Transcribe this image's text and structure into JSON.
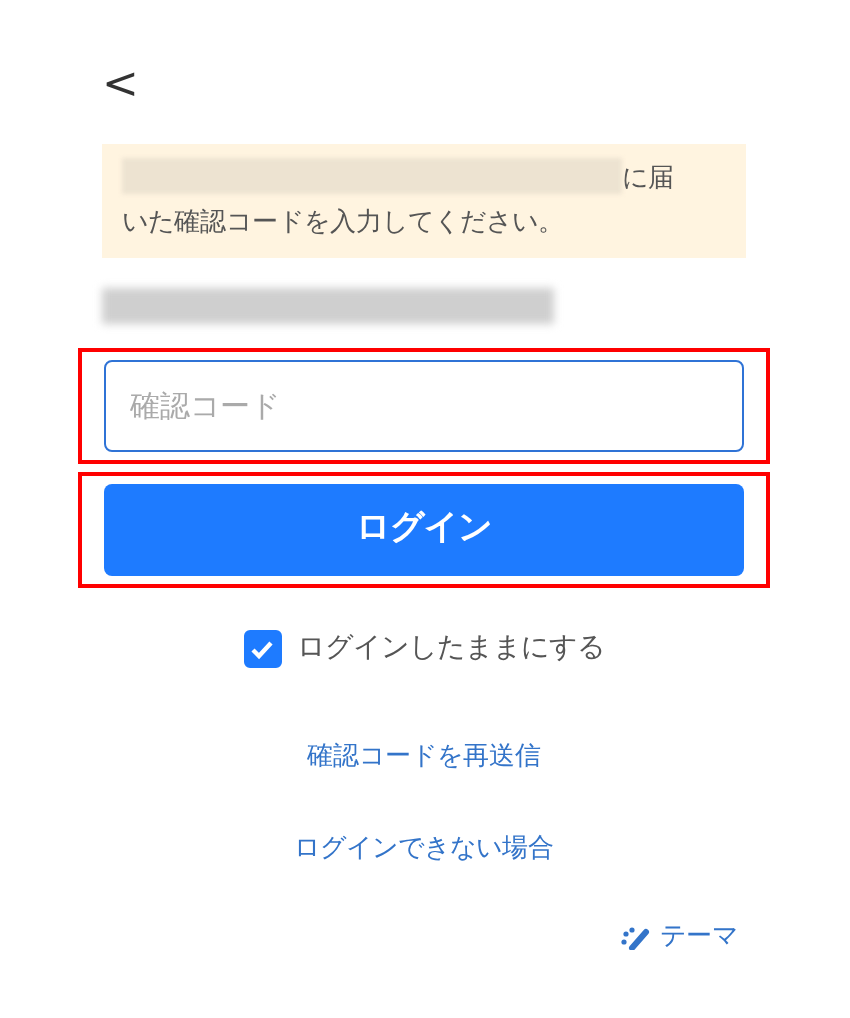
{
  "back_button": {
    "label": "<"
  },
  "notice": {
    "text": "に届いた確認コードを入力してください。"
  },
  "code_field": {
    "placeholder": "確認コード",
    "highlighted": true
  },
  "login_button": {
    "label": "ログイン",
    "highlighted": true
  },
  "remember": {
    "label": "ログインしたままにする",
    "checked": true
  },
  "links": [
    {
      "label": "確認コードを再送信"
    },
    {
      "label": "ログインできない場合"
    }
  ],
  "theme_button": {
    "label": "テーマ"
  }
}
